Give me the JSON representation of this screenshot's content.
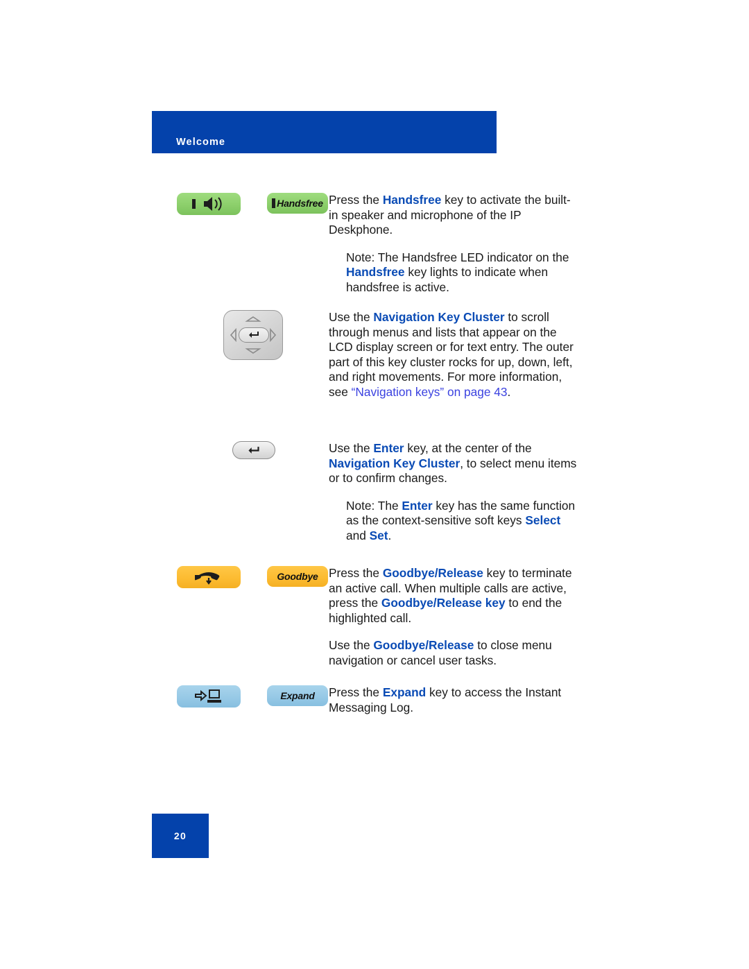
{
  "header": {
    "title": "Welcome",
    "bar_color": "#0442ab"
  },
  "footer": {
    "page_number": "20",
    "box_color": "#0442ab"
  },
  "colors": {
    "keyword_blue": "#0a4bb5",
    "link_blue": "#3b42e0",
    "body_text": "#1a1a1a",
    "key_green": "#8ccf6b",
    "key_orange": "#fcbc32",
    "key_blue": "#97c9e6",
    "key_grey": "#d6d6d6"
  },
  "sections": [
    {
      "id": "handsfree",
      "icon_key": {
        "name": "handsfree-speaker-key",
        "color": "green",
        "glyph": "speaker-waves-icon"
      },
      "label_key": {
        "name": "handsfree-label-key",
        "color": "green",
        "text": "Handsfree"
      },
      "paragraphs": [
        {
          "type": "body",
          "runs": [
            {
              "t": "Press the ",
              "s": "plain"
            },
            {
              "t": "Handsfree",
              "s": "kw"
            },
            {
              "t": " key to activate the built-in speaker and microphone of the IP Deskphone.",
              "s": "plain"
            }
          ]
        },
        {
          "type": "note",
          "runs": [
            {
              "t": "Note:  The Handsfree LED indicator on the ",
              "s": "plain"
            },
            {
              "t": "Handsfree",
              "s": "kw"
            },
            {
              "t": " key lights to indicate when handsfree is active.",
              "s": "plain"
            }
          ]
        }
      ]
    },
    {
      "id": "navigation-cluster",
      "icon_key": {
        "name": "navigation-key-cluster",
        "color": "grey",
        "glyph": "navigation-cluster-icon"
      },
      "label_key": null,
      "paragraphs": [
        {
          "type": "body",
          "runs": [
            {
              "t": "Use the ",
              "s": "plain"
            },
            {
              "t": "Navigation Key Cluster",
              "s": "kw"
            },
            {
              "t": " to scroll through menus and lists that appear on the LCD display screen or for text entry. The outer part of this key cluster rocks for up, down, left, and right movements. For more information, see ",
              "s": "plain"
            },
            {
              "t": "“Navigation keys” on page 43",
              "s": "lnk"
            },
            {
              "t": ".",
              "s": "plain"
            }
          ]
        }
      ]
    },
    {
      "id": "enter",
      "icon_key": {
        "name": "enter-key",
        "color": "grey",
        "glyph": "enter-return-icon"
      },
      "label_key": null,
      "paragraphs": [
        {
          "type": "body",
          "runs": [
            {
              "t": "Use the ",
              "s": "plain"
            },
            {
              "t": "Enter",
              "s": "kw"
            },
            {
              "t": " key, at the center of the ",
              "s": "plain"
            },
            {
              "t": "Navigation Key Cluster",
              "s": "kw"
            },
            {
              "t": ", to select menu items or to confirm changes.",
              "s": "plain"
            }
          ]
        },
        {
          "type": "note",
          "runs": [
            {
              "t": "Note:  The ",
              "s": "plain"
            },
            {
              "t": "Enter",
              "s": "kw"
            },
            {
              "t": " key has the same function as the context-sensitive soft keys ",
              "s": "plain"
            },
            {
              "t": "Select",
              "s": "kw"
            },
            {
              "t": " and ",
              "s": "plain"
            },
            {
              "t": "Set",
              "s": "kw"
            },
            {
              "t": ".",
              "s": "plain"
            }
          ]
        }
      ]
    },
    {
      "id": "goodbye-release",
      "icon_key": {
        "name": "goodbye-release-key",
        "color": "orange",
        "glyph": "handset-down-icon"
      },
      "label_key": {
        "name": "goodbye-label-key",
        "color": "orange",
        "text": "Goodbye"
      },
      "paragraphs": [
        {
          "type": "body",
          "runs": [
            {
              "t": "Press the ",
              "s": "plain"
            },
            {
              "t": "Goodbye/Release",
              "s": "kw"
            },
            {
              "t": " key to terminate an active call. When multiple calls are active, press the ",
              "s": "plain"
            },
            {
              "t": "Goodbye/Release key",
              "s": "kw"
            },
            {
              "t": " to end the highlighted call.",
              "s": "plain"
            }
          ]
        },
        {
          "type": "body",
          "runs": [
            {
              "t": "Use the ",
              "s": "plain"
            },
            {
              "t": "Goodbye/Release",
              "s": "kw"
            },
            {
              "t": " to close menu navigation or cancel user tasks.",
              "s": "plain"
            }
          ]
        }
      ]
    },
    {
      "id": "expand",
      "icon_key": {
        "name": "expand-key",
        "color": "blue",
        "glyph": "arrow-to-computer-icon"
      },
      "label_key": {
        "name": "expand-label-key",
        "color": "blue",
        "text": "Expand"
      },
      "paragraphs": [
        {
          "type": "body",
          "runs": [
            {
              "t": "Press the ",
              "s": "plain"
            },
            {
              "t": "Expand",
              "s": "kw"
            },
            {
              "t": " key to access the Instant Messaging Log.",
              "s": "plain"
            }
          ]
        }
      ]
    }
  ]
}
